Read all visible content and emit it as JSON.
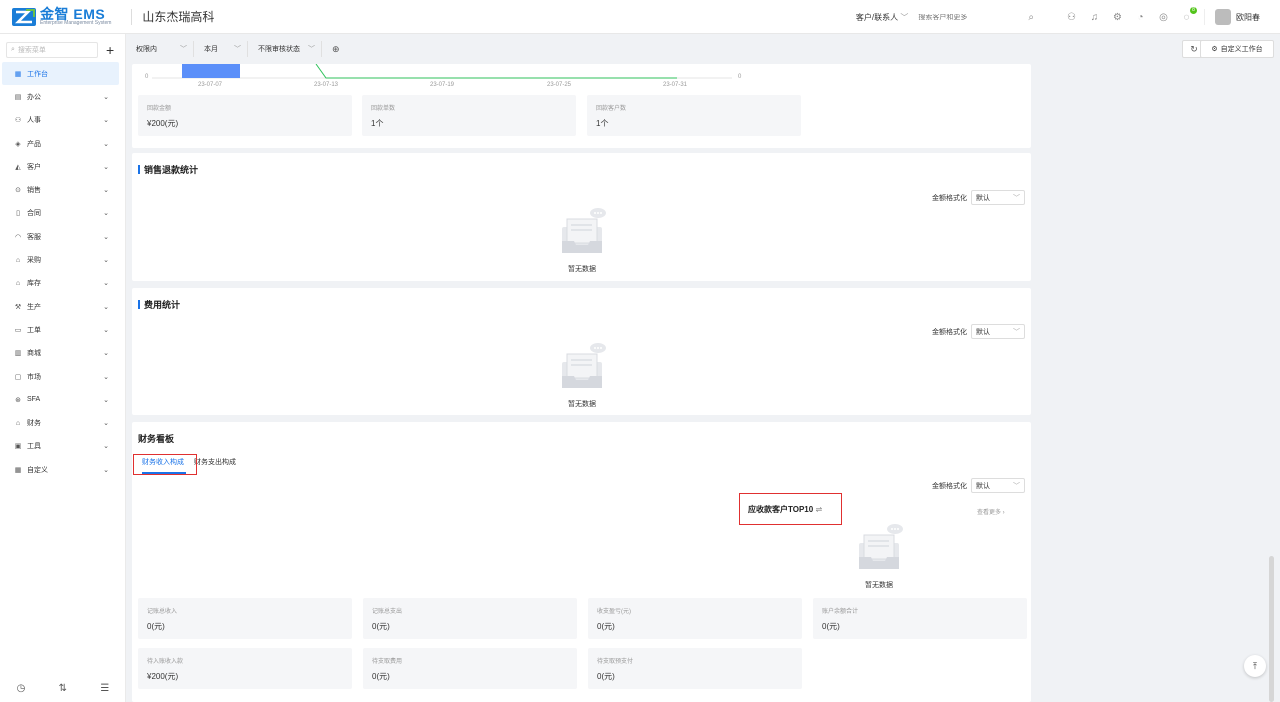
{
  "app": {
    "logo_main": "金智 EMS",
    "logo_sub": "Enterprise Management System",
    "company": "山东杰瑞高科"
  },
  "top": {
    "customer_select": "客户/联系人",
    "search_placeholder": "搜索客户和更多",
    "username": "欧阳春",
    "badge": "8"
  },
  "sidebar": {
    "search_placeholder": "搜索菜单",
    "items": [
      {
        "label": "工作台",
        "icon": "dashboard-icon",
        "active": true
      },
      {
        "label": "办公",
        "icon": "office-icon"
      },
      {
        "label": "人事",
        "icon": "people-icon"
      },
      {
        "label": "产品",
        "icon": "product-icon"
      },
      {
        "label": "客户",
        "icon": "customer-icon"
      },
      {
        "label": "销售",
        "icon": "sales-icon"
      },
      {
        "label": "合同",
        "icon": "contract-icon"
      },
      {
        "label": "客服",
        "icon": "service-icon"
      },
      {
        "label": "采购",
        "icon": "purchase-icon"
      },
      {
        "label": "库存",
        "icon": "inventory-icon"
      },
      {
        "label": "生产",
        "icon": "production-icon"
      },
      {
        "label": "工单",
        "icon": "workorder-icon"
      },
      {
        "label": "商城",
        "icon": "mall-icon"
      },
      {
        "label": "市场",
        "icon": "market-icon"
      },
      {
        "label": "SFA",
        "icon": "sfa-icon"
      },
      {
        "label": "财务",
        "icon": "finance-icon"
      },
      {
        "label": "工具",
        "icon": "tools-icon"
      },
      {
        "label": "自定义",
        "icon": "custom-icon"
      }
    ]
  },
  "filters": {
    "scope": "权限内",
    "period": "本月",
    "status": "不限审核状态",
    "custom_btn": "自定义工作台"
  },
  "chart": {
    "ticks": [
      "23-07-07",
      "23-07-13",
      "23-07-19",
      "23-07-25",
      "23-07-31"
    ],
    "y_left": "0",
    "y_right": "0"
  },
  "payment_stats": [
    {
      "label": "回款金额",
      "value": "¥200(元)"
    },
    {
      "label": "回款单数",
      "value": "1个"
    },
    {
      "label": "回款客户数",
      "value": "1个"
    }
  ],
  "refund": {
    "title": "销售退款统计",
    "fmt_label": "金额格式化",
    "fmt_value": "默认",
    "empty": "暂无数据"
  },
  "expense": {
    "title": "费用统计",
    "fmt_label": "金额格式化",
    "fmt_value": "默认",
    "empty": "暂无数据"
  },
  "finance": {
    "title": "财务看板",
    "tabs": [
      "财务收入构成",
      "财务支出构成"
    ],
    "fmt_label": "金额格式化",
    "fmt_value": "默认",
    "top10": "应收款客户TOP10",
    "more": "查看更多",
    "empty": "暂无数据",
    "stats": [
      {
        "label": "记账总收入",
        "value": "0(元)"
      },
      {
        "label": "记账总支出",
        "value": "0(元)"
      },
      {
        "label": "收支盈亏(元)",
        "value": "0(元)"
      },
      {
        "label": "账户余额合计",
        "value": "0(元)"
      },
      {
        "label": "待入账收入款",
        "value": "¥200(元)"
      },
      {
        "label": "待支取费用",
        "value": "0(元)"
      },
      {
        "label": "待支取预支付",
        "value": "0(元)"
      }
    ]
  }
}
